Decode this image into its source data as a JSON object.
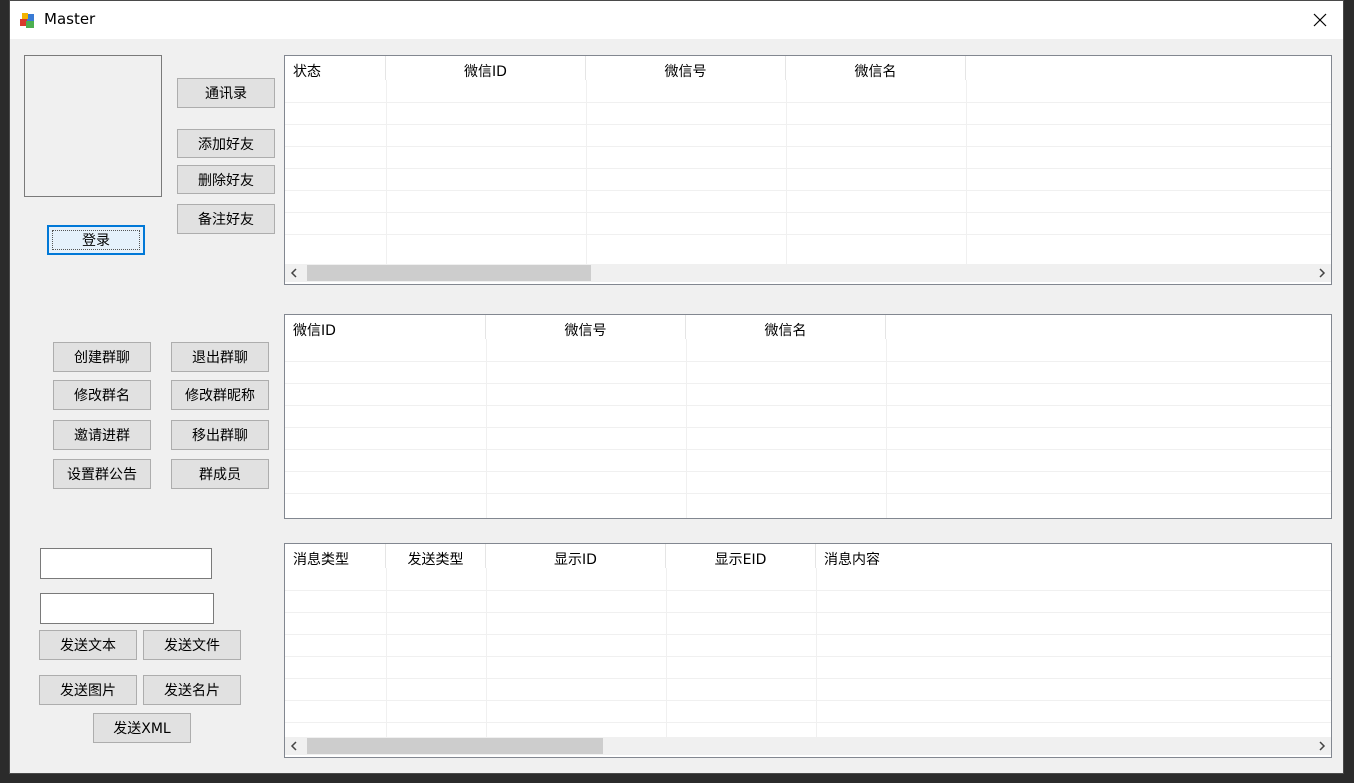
{
  "window": {
    "title": "Master"
  },
  "left_top": {
    "contacts_label": "通讯录",
    "add_friend_label": "添加好友",
    "delete_friend_label": "删除好友",
    "remark_friend_label": "备注好友",
    "login_label": "登录"
  },
  "group_buttons": {
    "create_group": "创建群聊",
    "quit_group": "退出群聊",
    "rename_group": "修改群名",
    "edit_group_nickname": "修改群昵称",
    "invite_to_group": "邀请进群",
    "remove_from_group": "移出群聊",
    "set_group_notice": "设置群公告",
    "group_members": "群成员"
  },
  "send": {
    "input1_value": "",
    "input2_value": "",
    "send_text": "发送文本",
    "send_file": "发送文件",
    "send_image": "发送图片",
    "send_card": "发送名片",
    "send_xml": "发送XML"
  },
  "contacts_table": {
    "columns": [
      "状态",
      "微信ID",
      "微信号",
      "微信名"
    ]
  },
  "groups_table": {
    "columns": [
      "微信ID",
      "微信号",
      "微信名"
    ]
  },
  "messages_table": {
    "columns": [
      "消息类型",
      "发送类型",
      "显示ID",
      "显示EID",
      "消息内容"
    ]
  }
}
